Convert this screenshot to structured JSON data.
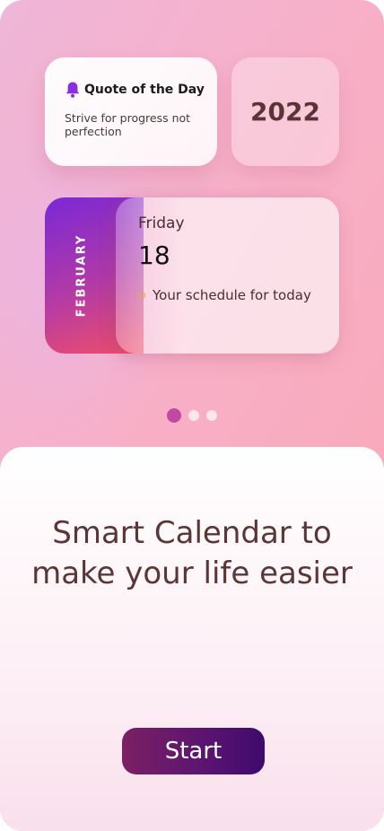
{
  "widgets": {
    "quote": {
      "title": "Quote of the Day",
      "text": "Strive for progress not perfection",
      "icon": "bell-icon"
    },
    "year": "2022",
    "date": {
      "month": "FEBRUARY",
      "weekday": "Friday",
      "day": "18",
      "schedule": "Your schedule for today"
    }
  },
  "pager": {
    "count": 3,
    "active_index": 0
  },
  "onboarding": {
    "headline": "Smart Calendar to make your life easier",
    "start_label": "Start"
  },
  "colors": {
    "accent": "#c049a5",
    "button_start": "#7b2063",
    "button_end": "#3e0a6e",
    "headline": "#5a3636"
  }
}
